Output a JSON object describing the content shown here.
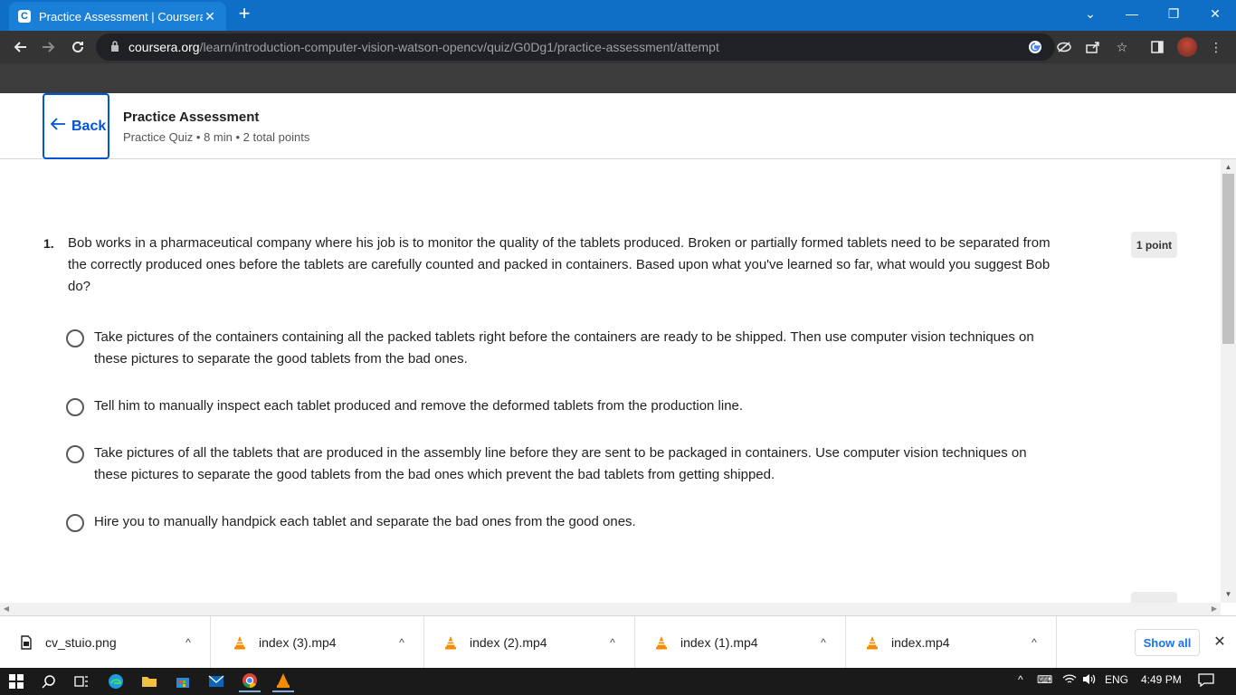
{
  "browser": {
    "tab_title": "Practice Assessment | Coursera",
    "tab_close": "✕",
    "new_tab": "+",
    "favicon_letter": "C",
    "url_host": "coursera.org",
    "url_path": "/learn/introduction-computer-vision-watson-opencv/quiz/G0Dg1/practice-assessment/attempt",
    "window_controls": {
      "dropdown": "⌄",
      "minimize": "—",
      "restore": "❐",
      "close": "✕"
    }
  },
  "header": {
    "back_label": "Back",
    "title": "Practice Assessment",
    "meta": "Practice Quiz • 8 min • 2 total points"
  },
  "question1": {
    "number": "1.",
    "text": "Bob works in a pharmaceutical company where his job is to monitor the quality of the tablets produced. Broken or partially formed tablets need to be separated from the correctly produced ones before the tablets are carefully counted and packed in containers. Based upon what you've learned so far, what would you suggest Bob do?",
    "points": "1 point",
    "options": [
      {
        "label": "Take pictures of the containers containing all the packed tablets right before the containers are ready to be shipped. Then use computer vision techniques on these pictures to separate the good tablets from the bad ones."
      },
      {
        "label": "Tell him to manually inspect each tablet produced and remove the deformed tablets from the production line."
      },
      {
        "label": "Take pictures of all the tablets that are produced in the assembly line before they are sent to be packaged in containers. Use computer vision techniques on these pictures to separate the good tablets from the bad ones which prevent the bad tablets from getting shipped."
      },
      {
        "label": "Hire you to manually handpick each tablet and separate the bad ones from the good ones."
      }
    ]
  },
  "downloads": {
    "items": [
      {
        "name": "cv_stuio.png",
        "type": "image"
      },
      {
        "name": "index (3).mp4",
        "type": "vlc"
      },
      {
        "name": "index (2).mp4",
        "type": "vlc"
      },
      {
        "name": "index (1).mp4",
        "type": "vlc"
      },
      {
        "name": "index.mp4",
        "type": "vlc"
      }
    ],
    "show_all": "Show all",
    "caret": "^",
    "close": "✕"
  },
  "taskbar": {
    "language": "ENG",
    "time": "4:49 PM"
  },
  "colors": {
    "brand_blue": "#0056d2",
    "chrome_tab": "#0f6ec6",
    "chrome_toolbar": "#343434"
  }
}
